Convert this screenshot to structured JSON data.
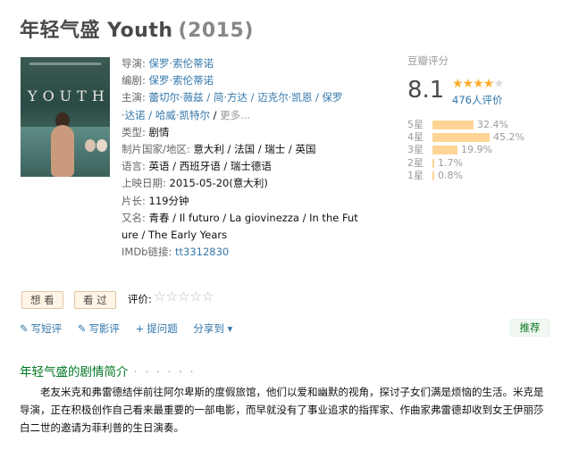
{
  "header": {
    "title": "年轻气盛 Youth",
    "year": "(2015)"
  },
  "poster": {
    "text": "YOUTH"
  },
  "info": {
    "director_label": "导演:",
    "director": "保罗·索伦蒂诺",
    "writer_label": "编剧:",
    "writer": "保罗·索伦蒂诺",
    "cast_label": "主演:",
    "cast_line1": "蕾切尔·薇兹 / 简·方达 / 迈克尔·凯恩 / 保罗",
    "cast_line2": "·达诺 / 哈威·凯特尔",
    "cast_more": "更多...",
    "genre_label": "类型:",
    "genre": "剧情",
    "country_label": "制片国家/地区:",
    "country": "意大利 / 法国 / 瑞士 / 英国",
    "language_label": "语言:",
    "language": "英语 / 西班牙语 / 瑞士德语",
    "release_label": "上映日期:",
    "release": "2015-05-20(意大利)",
    "runtime_label": "片长:",
    "runtime": "119分钟",
    "aka_label": "又名:",
    "aka_line1": "青春 / Il futuro / La giovinezza / In the Fut",
    "aka_line2": "ure / The Early Years",
    "imdb_label": "IMDb链接:",
    "imdb": "tt3312830"
  },
  "rating": {
    "label": "豆瓣评分",
    "score": "8.1",
    "stars_filled": 4,
    "stars_total": 5,
    "count": "476人评价",
    "breakdown": [
      {
        "label": "5星",
        "pct": "32.4%",
        "value": 32.4
      },
      {
        "label": "4星",
        "pct": "45.2%",
        "value": 45.2
      },
      {
        "label": "3星",
        "pct": "19.9%",
        "value": 19.9
      },
      {
        "label": "2星",
        "pct": "1.7%",
        "value": 1.7
      },
      {
        "label": "1星",
        "pct": "0.8%",
        "value": 0.8
      }
    ]
  },
  "interest": {
    "want_label": "想 看",
    "seen_label": "看 过",
    "rate_label": "评价:"
  },
  "actions": {
    "short_review": "写短评",
    "review": "写影评",
    "question": "提问题",
    "share": "分享到",
    "recommend": "推荐"
  },
  "synopsis": {
    "title": "年轻气盛的剧情简介",
    "dots": "· · · · · ·",
    "text": "老友米克和弗雷德结伴前往阿尔卑斯的度假旅馆，他们以爱和幽默的视角，探讨子女们满是烦恼的生活。米克是导演，正在积极创作自己看来最重要的一部电影，而早就没有了事业追求的指挥家、作曲家弗雷德却收到女王伊丽莎白二世的邀请为菲利普的生日演奏。"
  },
  "colors": {
    "link": "#3377aa",
    "star": "#ffac2d",
    "bar": "#ffd596",
    "section_title": "#007722"
  }
}
